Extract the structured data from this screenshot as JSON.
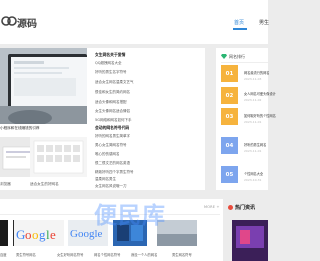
{
  "header": {
    "logo_text": "源码",
    "nav_home": "首页",
    "nav_next": "男生"
  },
  "main": {
    "hero_caption": "小程序和在线赚钱的引荐",
    "thumbs": [
      {
        "caption": "浏览器"
      },
      {
        "caption": "适合女生的好网名"
      }
    ]
  },
  "list": {
    "groups": [
      {
        "title": "女生网名关于爱情",
        "items": [
          "QQ超拽网名大全",
          "好听的男生名字符号",
          "适合女生网名温柔文艺气",
          "很佳和女生的简约网名",
          "适合头像和网名搭配",
          "女生头像网名适合情侣",
          "5G网络和网名如何下手"
        ]
      },
      {
        "title": "会动的网名符号代码",
        "items": [
          "好听的网名男生简单字",
          "男心女生简网名符号",
          "唯心的伤感网名",
          "很二很文艺的网名英语",
          "精致好听四个字男生符号",
          "温柔网名男生",
          "女生网名风说哦一刀",
          "适合的名字女生网名"
        ]
      }
    ]
  },
  "side": {
    "title": "网名排行",
    "ranks": [
      {
        "num": "01",
        "title": "网名最流行的网名",
        "date": "2023-11-03"
      },
      {
        "num": "02",
        "title": "女人网名可爱头像设计",
        "date": "2023-11-02"
      },
      {
        "num": "03",
        "title": "如何取好听的个性网名",
        "date": "2023-11-01"
      },
      {
        "num": "04",
        "title": "好听的男生网名",
        "date": "2023-11-01"
      },
      {
        "num": "05",
        "title": "个性网名大全",
        "date": "2023-10-31"
      }
    ]
  },
  "bottom": {
    "more": "MORE +",
    "captions": [
      "百度",
      "男生符号网名",
      "女生好听网名符号",
      "网名个性网名符号",
      "我没一个人的网名",
      "男生网名符号"
    ],
    "hot_title": "热门资讯"
  },
  "watermark": "便民库",
  "colors": {
    "accent": "#2f86d6",
    "rank_orange": "#f6b33d",
    "rank_blue": "#7da5ee",
    "hot_red": "#e84b3c"
  }
}
